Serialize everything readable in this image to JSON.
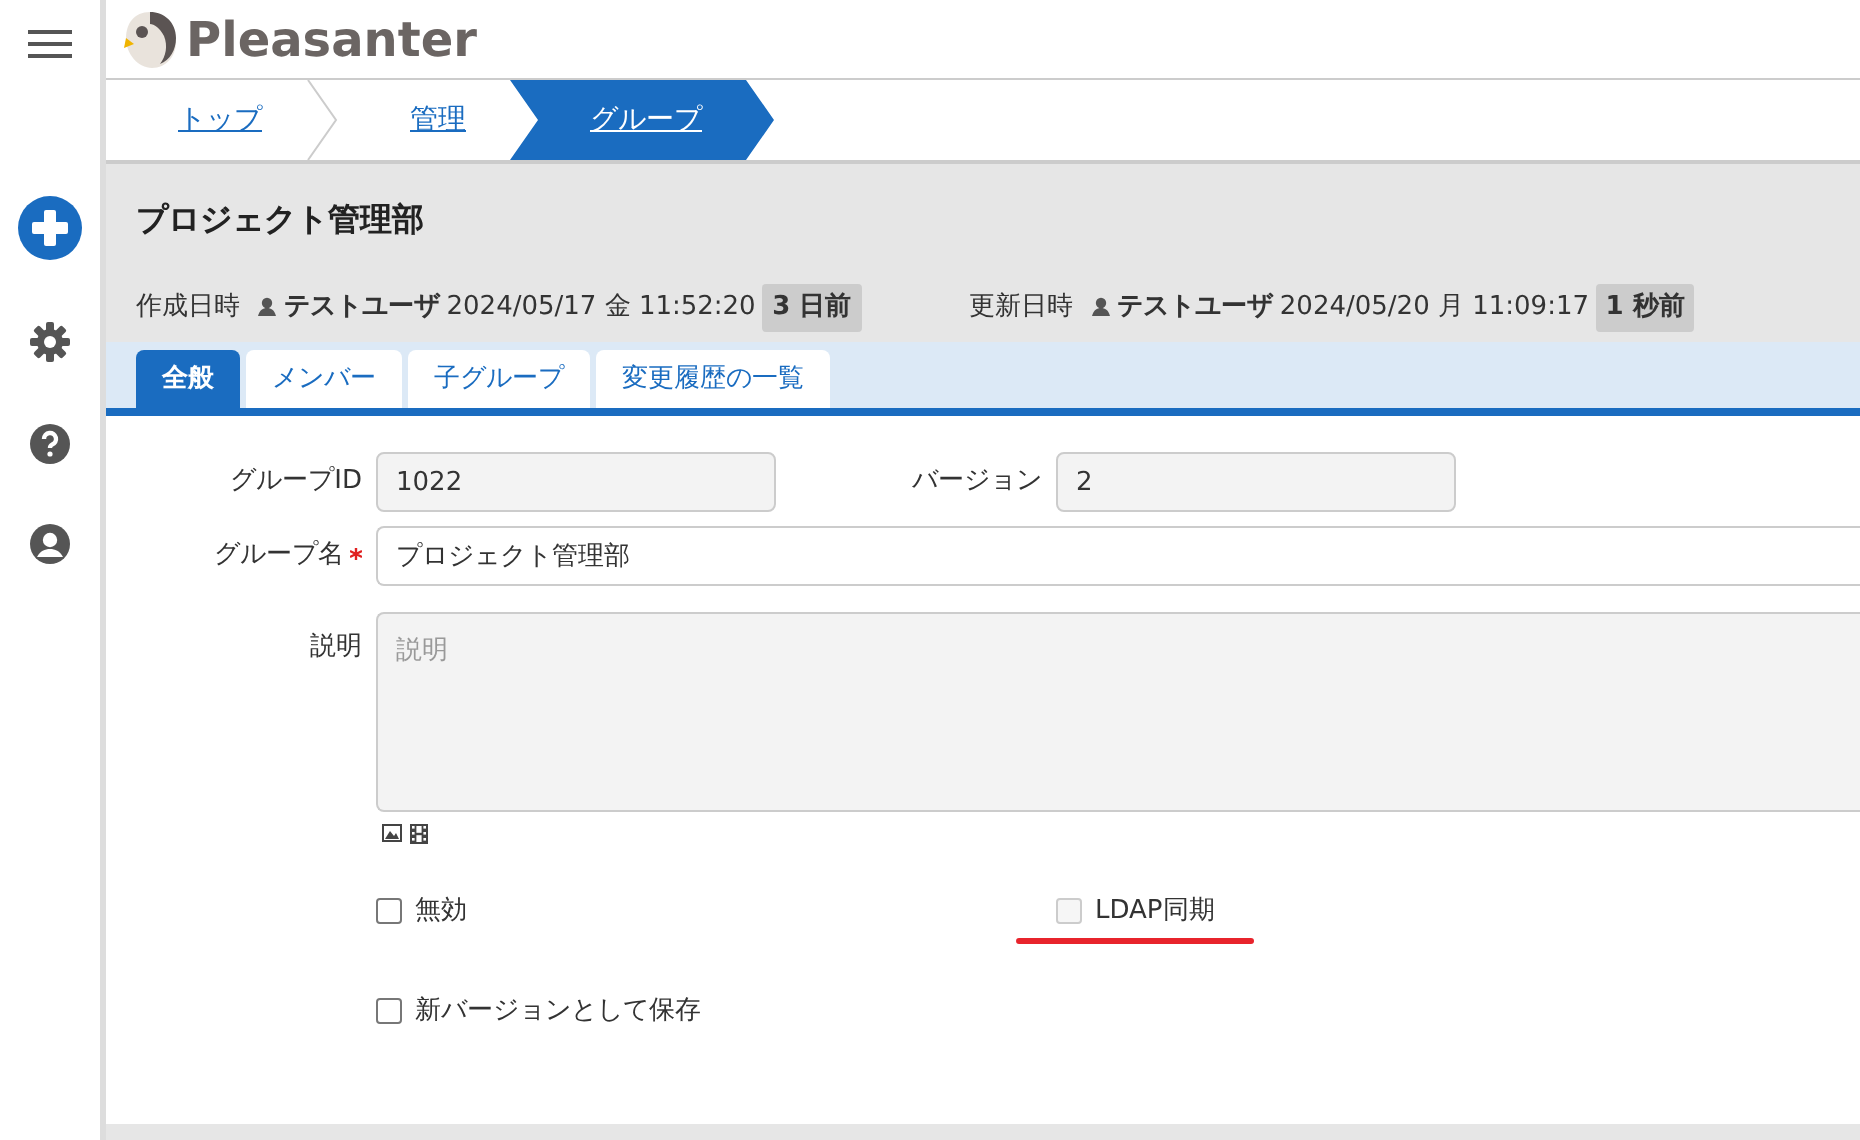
{
  "app": {
    "logo_text": "Pleasanter"
  },
  "sidebar": [
    {
      "kind": "menu"
    },
    {
      "kind": "add"
    },
    {
      "kind": "settings"
    },
    {
      "kind": "help"
    },
    {
      "kind": "user"
    }
  ],
  "breadcrumb": [
    {
      "label": "トップ",
      "selected": false
    },
    {
      "label": "管理",
      "selected": false
    },
    {
      "label": "グループ",
      "selected": true
    }
  ],
  "title": "プロジェクト管理部",
  "meta": [
    {
      "label": "作成日時",
      "user": "テストユーザ",
      "datetime": "2024/05/17 金 11:52:20",
      "ago": "3 日前"
    },
    {
      "label": "更新日時",
      "user": "テストユーザ",
      "datetime": "2024/05/20 月 11:09:17",
      "ago": "1 秒前"
    }
  ],
  "tabs": [
    {
      "label": "全般",
      "selected": true
    },
    {
      "label": "メンバー",
      "selected": false
    },
    {
      "label": "子グループ",
      "selected": false
    },
    {
      "label": "変更履歴の一覧",
      "selected": false
    }
  ],
  "fields": {
    "group_id": {
      "label": "グループID",
      "value": "1022"
    },
    "version": {
      "label": "バージョン",
      "value": "2"
    },
    "group_name": {
      "label": "グループ名",
      "required": true,
      "value": "プロジェクト管理部"
    },
    "description": {
      "label": "説明",
      "placeholder": "説明"
    }
  },
  "checkboxes": [
    {
      "label": "無効",
      "checked": false,
      "disabled": false,
      "highlighted": false
    },
    {
      "label": "LDAP同期",
      "checked": false,
      "disabled": true,
      "highlighted": true
    },
    {
      "label": "新バージョンとして保存",
      "checked": false,
      "disabled": false,
      "highlighted": false
    }
  ]
}
